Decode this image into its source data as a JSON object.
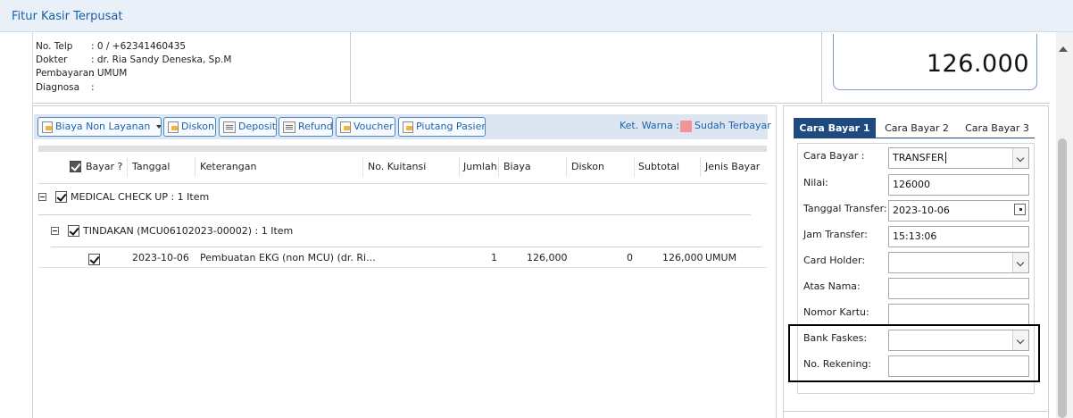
{
  "window": {
    "title": "Fitur Kasir Terpusat"
  },
  "patient": {
    "rows": [
      {
        "label": "No. Telp",
        "value": ": 0 / +62341460435"
      },
      {
        "label": "Dokter",
        "value": ": dr. Ria Sandy Deneska, Sp.M"
      },
      {
        "label": "Pembayaran",
        "value": ": UMUM"
      },
      {
        "label": "Diagnosa",
        "value": ":"
      }
    ]
  },
  "total": {
    "amount": "126.000"
  },
  "toolbar": {
    "biaya_non_layanan": "Biaya Non Layanan",
    "diskon": "Diskon",
    "deposit": "Deposit",
    "refund": "Refund",
    "voucher": "Voucher",
    "piutang_pasien": "Piutang Pasien",
    "legend_label": "Ket. Warna :",
    "legend_paid": "Sudah Terbayar"
  },
  "colors": {
    "paid": "#f0949a",
    "accent": "#1b62ad",
    "tab_active": "#1f4a80"
  },
  "grid": {
    "columns": {
      "bayar": "Bayar ?",
      "tanggal": "Tanggal",
      "keterangan": "Keterangan",
      "kuitansi": "No. Kuitansi",
      "jumlah": "Jumlah",
      "biaya": "Biaya",
      "diskon": "Diskon",
      "subtotal": "Subtotal",
      "jenis_bayar": "Jenis Bayar"
    },
    "group1": "MEDICAL CHECK UP : 1 Item",
    "group2": "TINDAKAN (MCU06102023-00002) : 1 Item",
    "rows": [
      {
        "tanggal": "2023-10-06",
        "keterangan": "Pembuatan EKG (non MCU) (dr. Ri...",
        "kuitansi": "",
        "jumlah": "1",
        "biaya": "126,000",
        "diskon": "0",
        "subtotal": "126,000",
        "jenis_bayar": "UMUM"
      }
    ]
  },
  "payment": {
    "tabs": [
      "Cara Bayar 1",
      "Cara Bayar 2",
      "Cara Bayar 3"
    ],
    "fields": {
      "cara_bayar": {
        "label": "Cara Bayar :",
        "value": "TRANSFER"
      },
      "nilai": {
        "label": "Nilai:",
        "value": "126000"
      },
      "tanggal_transfer": {
        "label": "Tanggal Transfer:",
        "value": "2023-10-06"
      },
      "jam_transfer": {
        "label": "Jam Transfer:",
        "value": "15:13:06"
      },
      "card_holder": {
        "label": "Card Holder:",
        "value": ""
      },
      "atas_nama": {
        "label": "Atas Nama:",
        "value": ""
      },
      "nomor_kartu": {
        "label": "Nomor Kartu:",
        "value": ""
      },
      "bank_faskes": {
        "label": "Bank Faskes:",
        "value": ""
      },
      "no_rekening": {
        "label": "No. Rekening:",
        "value": ""
      }
    }
  }
}
